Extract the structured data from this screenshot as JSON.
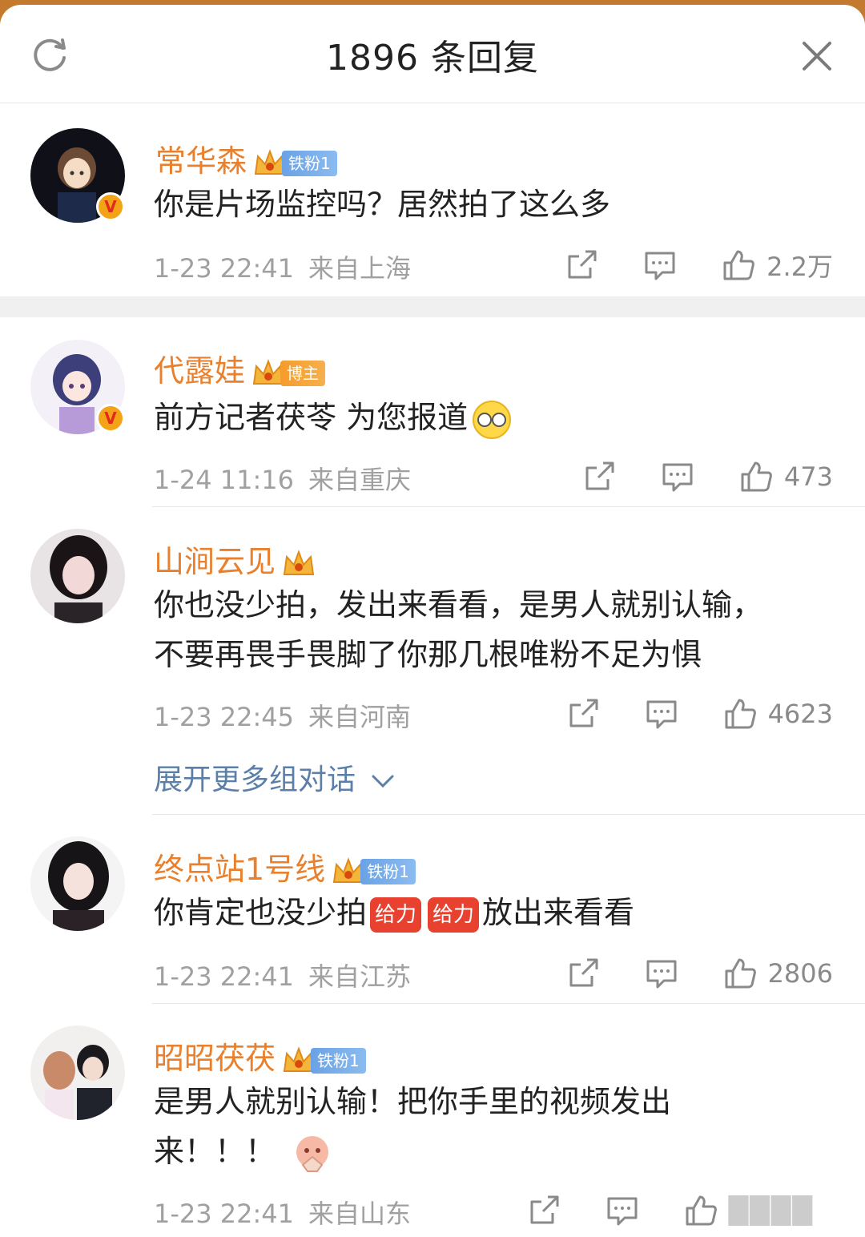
{
  "header": {
    "title": "1896 条回复"
  },
  "comments": [
    {
      "username": "常华森",
      "fan_badge": "铁粉1",
      "text": "你是片场监控吗？居然拍了这么多",
      "date": "1-23 22:41",
      "location": "来自上海",
      "likes": "2.2万"
    },
    {
      "username": "代露娃",
      "fan_badge": "博主",
      "text": "前方记者茯苓 为您报道",
      "date": "1-24 11:16",
      "location": "来自重庆",
      "likes": "473"
    },
    {
      "username": "山涧云见",
      "text_line1": "你也没少拍，发出来看看，是男人就别认输，",
      "text_line2": "不要再畏手畏脚了你那几根唯粉不足为惧",
      "date": "1-23 22:45",
      "location": "来自河南",
      "likes": "4623"
    },
    {
      "username": "终点站1号线",
      "fan_badge": "铁粉1",
      "text_part1": "你肯定也没少拍",
      "emoji_label": "给力",
      "text_part2": "放出来看看",
      "date": "1-23 22:41",
      "location": "来自江苏",
      "likes": "2806"
    },
    {
      "username": "昭昭茯茯",
      "fan_badge": "铁粉1",
      "text_line1": "是男人就别认输！把你手里的视频发出",
      "text_line2": "来！！！",
      "date": "1-23 22:41",
      "location": "来自山东"
    }
  ],
  "expand_more": "展开更多组对话",
  "colors": {
    "username": "#e8802d",
    "link": "#5b7fa8",
    "meta": "#a0a0a0"
  }
}
